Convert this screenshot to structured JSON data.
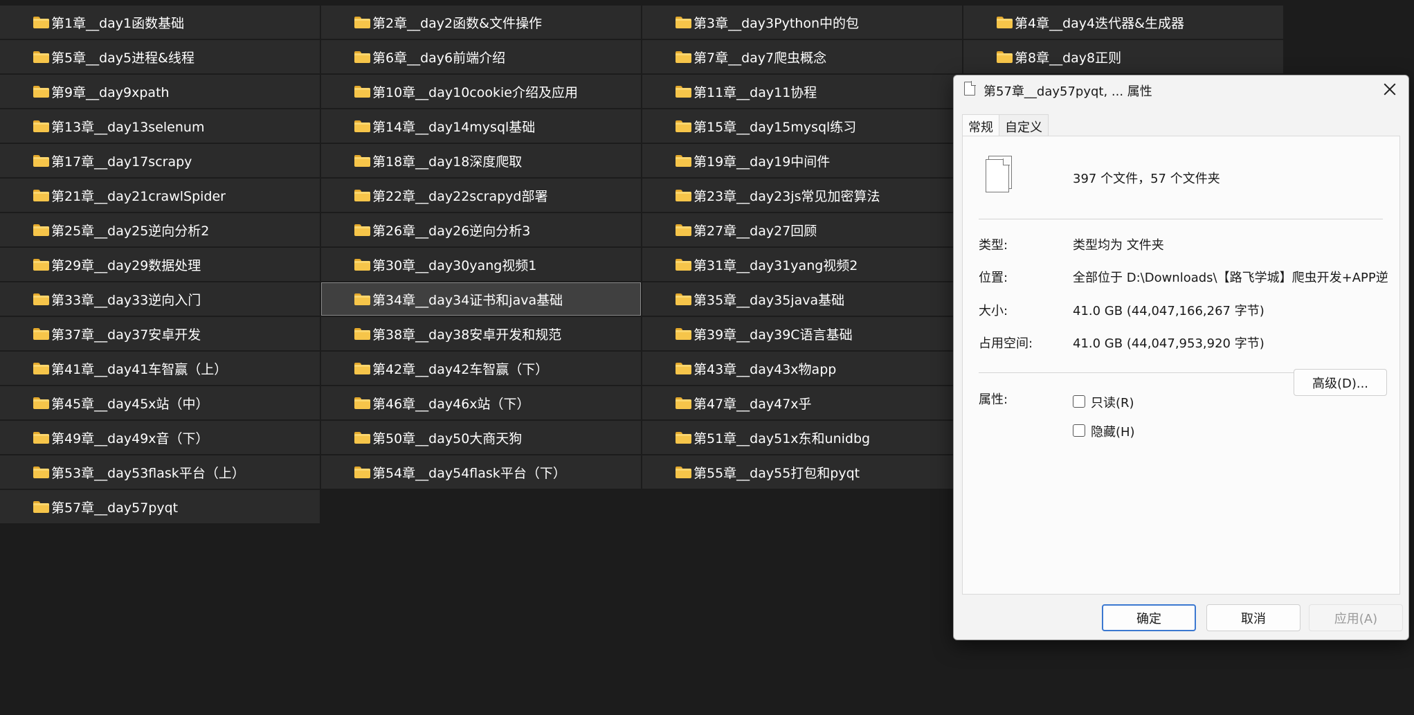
{
  "folders": [
    "第1章__day1函数基础",
    "第2章__day2函数&文件操作",
    "第3章__day3Python中的包",
    "第4章__day4迭代器&生成器",
    "第5章__day5进程&线程",
    "第6章__day6前端介绍",
    "第7章__day7爬虫概念",
    "第8章__day8正则",
    "第9章__day9xpath",
    "第10章__day10cookie介绍及应用",
    "第11章__day11协程",
    "",
    "第13章__day13selenum",
    "第14章__day14mysql基础",
    "第15章__day15mysql练习",
    "",
    "第17章__day17scrapy",
    "第18章__day18深度爬取",
    "第19章__day19中间件",
    "",
    "第21章__day21crawlSpider",
    "第22章__day22scrapyd部署",
    "第23章__day23js常见加密算法",
    "",
    "第25章__day25逆向分析2",
    "第26章__day26逆向分析3",
    "第27章__day27回顾",
    "",
    "第29章__day29数据处理",
    "第30章__day30yang视频1",
    "第31章__day31yang视频2",
    "",
    "第33章__day33逆向入门",
    "第34章__day34证书和java基础",
    "第35章__day35java基础",
    "",
    "第37章__day37安卓开发",
    "第38章__day38安卓开发和规范",
    "第39章__day39C语言基础",
    "",
    "第41章__day41车智赢（上）",
    "第42章__day42车智赢（下）",
    "第43章__day43x物app",
    "",
    "第45章__day45x站（中）",
    "第46章__day46x站（下）",
    "第47章__day47x乎",
    "",
    "第49章__day49x音（下）",
    "第50章__day50大商天狗",
    "第51章__day51x东和unidbg",
    "",
    "第53章__day53flask平台（上）",
    "第54章__day54flask平台（下）",
    "第55章__day55打包和pyqt",
    "",
    "第57章__day57pyqt"
  ],
  "selected_folder": "第34章__day34证书和java基础",
  "dialog": {
    "title": "第57章__day57pyqt, ... 属性",
    "tabs": [
      "常规",
      "自定义"
    ],
    "active_tab": "常规",
    "file_count": "397 个文件，57 个文件夹",
    "type_label": "类型:",
    "type_value": "类型均为 文件夹",
    "location_label": "位置:",
    "location_value": "全部位于 D:\\Downloads\\【路飞学城】爬虫开发+APP逆",
    "size_label": "大小:",
    "size_value": "41.0 GB (44,047,166,267 字节)",
    "disk_label": "占用空间:",
    "disk_value": "41.0 GB (44,047,953,920 字节)",
    "attr_label": "属性:",
    "readonly_label": "只读(R)",
    "readonly_checked": false,
    "hidden_label": "隐藏(H)",
    "hidden_checked": false,
    "advanced_button": "高级(D)...",
    "ok_button": "确定",
    "cancel_button": "取消",
    "apply_button": "应用(A)"
  },
  "icons": {
    "folder": "folder-icon",
    "document": "document-icon",
    "close": "close-icon"
  },
  "colors": {
    "background": "#1c1c1c",
    "tile": "#2b2b2b",
    "folder": "#f6c54a",
    "accent": "#3b78d0"
  }
}
